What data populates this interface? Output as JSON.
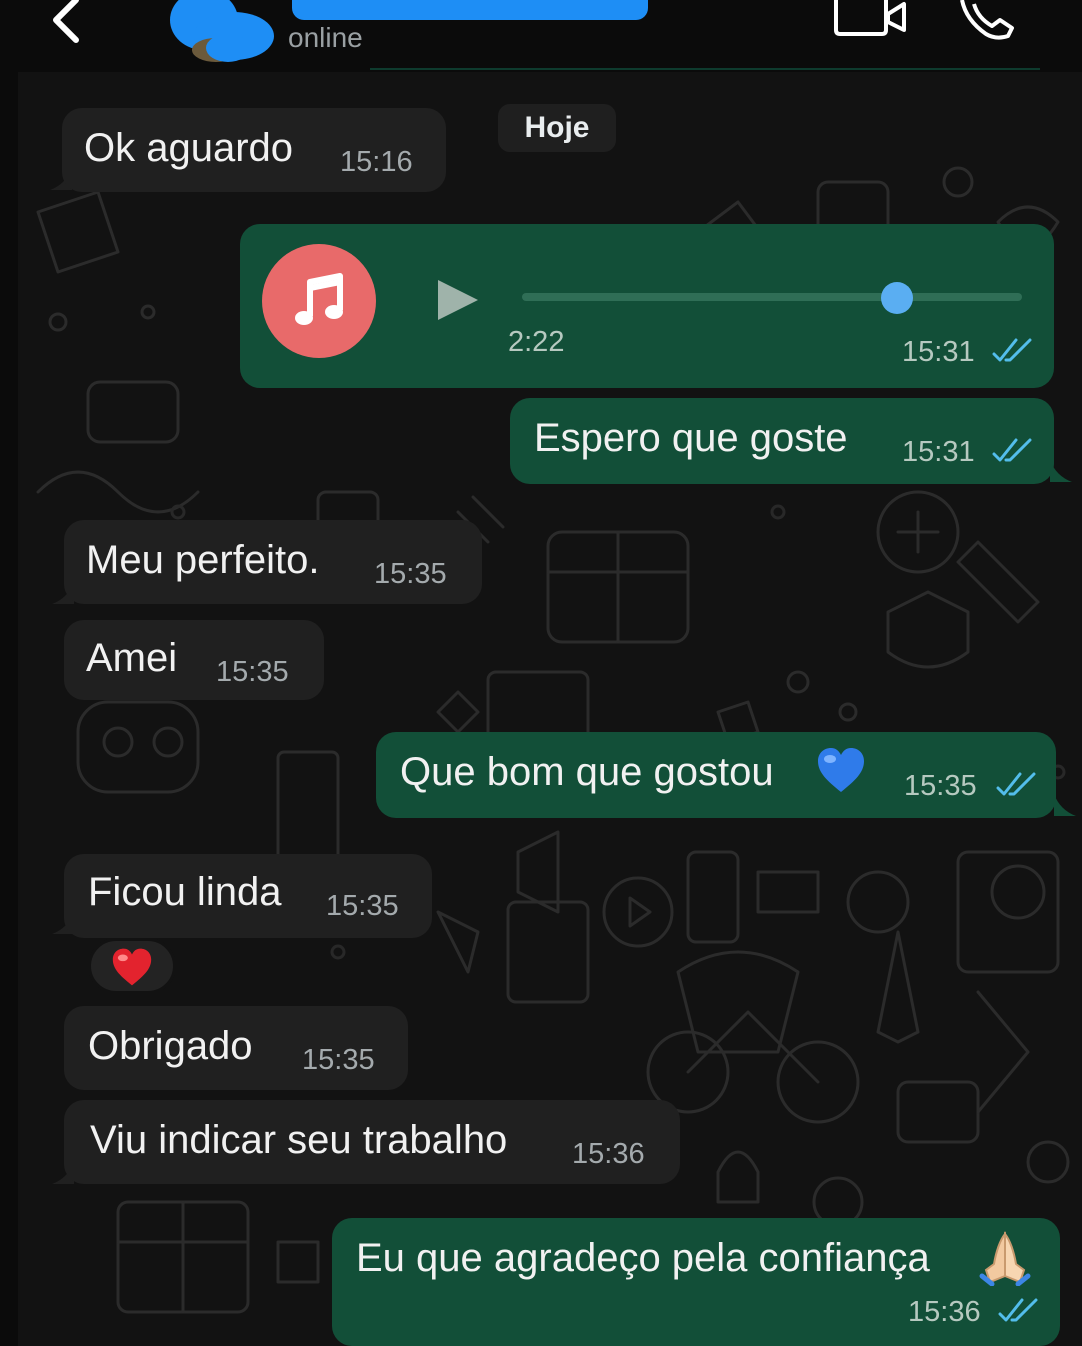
{
  "header": {
    "status": "online"
  },
  "date_separator": "Hoje",
  "messages": [
    {
      "direction": "in",
      "text": "Ok aguardo",
      "time": "15:16"
    },
    {
      "direction": "out",
      "type": "audio",
      "duration": "2:22",
      "playback_progress": 0.75,
      "time": "15:31",
      "read": true
    },
    {
      "direction": "out",
      "text": "Espero que goste",
      "time": "15:31",
      "read": true
    },
    {
      "direction": "in",
      "text": "Meu perfeito.",
      "time": "15:35"
    },
    {
      "direction": "in",
      "text": "Amei",
      "time": "15:35"
    },
    {
      "direction": "out",
      "text": "Que bom que gostou",
      "emoji": "blue-heart",
      "time": "15:35",
      "read": true
    },
    {
      "direction": "in",
      "text": "Ficou linda",
      "time": "15:35",
      "reaction": "red-heart"
    },
    {
      "direction": "in",
      "text": "Obrigado",
      "time": "15:35"
    },
    {
      "direction": "in",
      "text": "Viu indicar seu trabalho",
      "time": "15:36"
    },
    {
      "direction": "out",
      "text": "Eu que agradeço pela confiança",
      "emoji": "folded-hands",
      "time": "15:36",
      "read": true
    }
  ],
  "colors": {
    "incoming_bubble": "#202020",
    "outgoing_bubble": "#124f38",
    "read_ticks": "#53bdeb",
    "chat_background": "#121212"
  }
}
